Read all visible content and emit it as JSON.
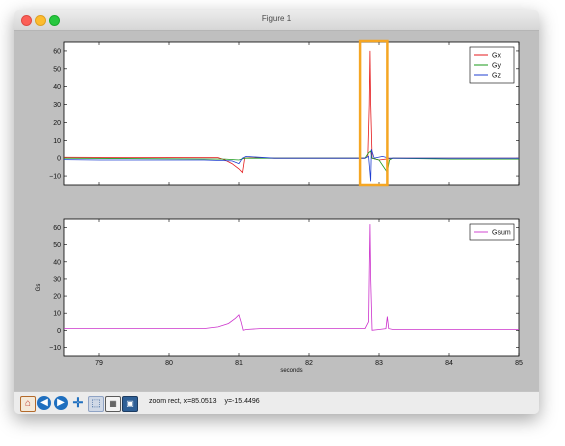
{
  "window": {
    "title": "Figure 1"
  },
  "toolbar": {
    "buttons": [
      {
        "name": "home-button",
        "icon": "home-icon"
      },
      {
        "name": "back-button",
        "icon": "back-arrow-icon"
      },
      {
        "name": "forward-button",
        "icon": "forward-arrow-icon"
      },
      {
        "name": "pan-button",
        "icon": "move-icon"
      },
      {
        "name": "zoom-button",
        "icon": "zoom-rect-icon"
      },
      {
        "name": "subplots-button",
        "icon": "subplots-icon"
      },
      {
        "name": "save-button",
        "icon": "save-icon"
      }
    ],
    "status_mode": "zoom rect, x=85.0513",
    "status_y": "y=-15.4496"
  },
  "highlight": {
    "color": "#f5a623",
    "x_range": [
      82.73,
      83.12
    ]
  },
  "chart_data": [
    {
      "type": "line",
      "xlim": [
        78.5,
        85
      ],
      "ylim": [
        -15,
        65
      ],
      "xticks": [
        79,
        80,
        81,
        82,
        83,
        84,
        85
      ],
      "yticks": [
        -10,
        0,
        10,
        20,
        30,
        40,
        50,
        60
      ],
      "ytick_labels": [
        "−10",
        "0",
        "10",
        "20",
        "30",
        "40",
        "50",
        "60"
      ],
      "show_xtick_labels": false,
      "xlabel": "",
      "ylabel": "",
      "legend": "top-right",
      "series": [
        {
          "name": "Gx",
          "color": "#e41a1c",
          "x": [
            78.5,
            80.7,
            80.8,
            80.9,
            81.0,
            81.05,
            81.08,
            81.15,
            81.5,
            82.8,
            82.84,
            82.86,
            82.87,
            82.88,
            82.9,
            83.0,
            83.2,
            84.0,
            85.0
          ],
          "y": [
            0.5,
            0.3,
            -1,
            -3,
            -6,
            -8,
            0,
            0.2,
            0,
            0,
            1,
            30,
            60,
            30,
            0,
            -1,
            0,
            0,
            0
          ]
        },
        {
          "name": "Gy",
          "color": "#1a9a1a",
          "x": [
            78.5,
            80.8,
            81.0,
            81.08,
            81.2,
            82.8,
            82.85,
            82.88,
            82.9,
            83.0,
            83.12,
            83.15,
            83.2,
            84.0,
            85.0
          ],
          "y": [
            0,
            -0.5,
            -1,
            0,
            0,
            0,
            3,
            4,
            0,
            -1,
            -8,
            -1,
            0,
            -0.5,
            -0.5
          ]
        },
        {
          "name": "Gz",
          "color": "#1f3fd1",
          "x": [
            78.5,
            79.0,
            80.5,
            80.9,
            81.0,
            81.05,
            81.1,
            81.5,
            82.8,
            82.85,
            82.87,
            82.88,
            82.89,
            82.93,
            83.05,
            83.15,
            84.0,
            85.0
          ],
          "y": [
            -0.8,
            -1,
            -1,
            -1.5,
            -3,
            0,
            1,
            0,
            0,
            1,
            -8,
            -13,
            5,
            0,
            1,
            0,
            0,
            0
          ]
        }
      ]
    },
    {
      "type": "line",
      "xlim": [
        78.5,
        85
      ],
      "ylim": [
        -15,
        65
      ],
      "xticks": [
        79,
        80,
        81,
        82,
        83,
        84,
        85
      ],
      "yticks": [
        -10,
        0,
        10,
        20,
        30,
        40,
        50,
        60
      ],
      "ytick_labels": [
        "−10",
        "0",
        "10",
        "20",
        "30",
        "40",
        "50",
        "60"
      ],
      "show_xtick_labels": true,
      "xlabel": "seconds",
      "ylabel": "Gs",
      "legend": "top-right",
      "series": [
        {
          "name": "Gsum",
          "color": "#cc33cc",
          "x": [
            78.5,
            80.5,
            80.7,
            80.85,
            80.95,
            81.0,
            81.03,
            81.06,
            81.1,
            81.3,
            82.8,
            82.85,
            82.86,
            82.87,
            82.88,
            82.9,
            83.0,
            83.1,
            83.12,
            83.14,
            83.2,
            84.0,
            85.0
          ],
          "y": [
            1,
            1,
            2,
            4,
            7,
            9,
            5,
            0,
            0.5,
            1,
            1,
            5,
            35,
            62,
            30,
            0,
            0.5,
            1,
            8,
            1,
            0.5,
            0.5,
            0.5
          ]
        }
      ]
    }
  ]
}
